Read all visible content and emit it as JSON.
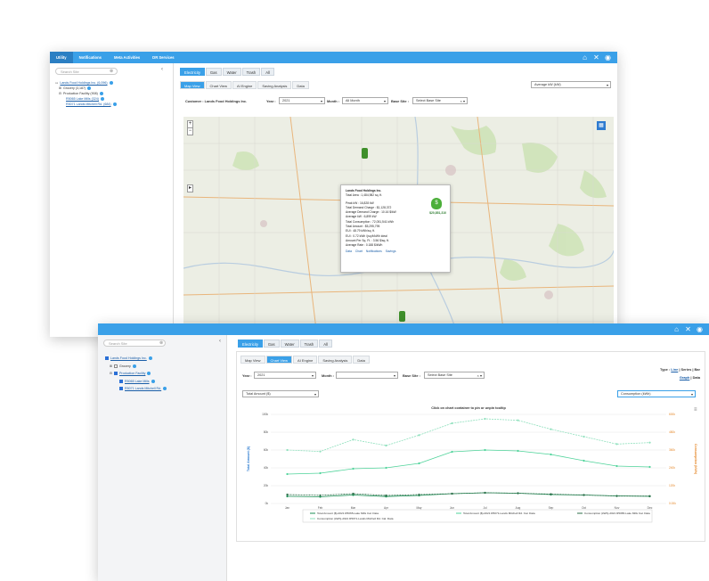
{
  "back_window": {
    "nav": [
      "Utility",
      "Notifications",
      "Meta Activities",
      "DR Services"
    ],
    "search_placeholder": "Search Site",
    "tree": {
      "root": "Lands Food Holdings Inc. (6,096)",
      "grocery": "Grocery (3,187)",
      "production": "Production Facility (908)",
      "site1": "R5065 Lake Mills (324)",
      "site2": "R5071 Lands Mitchell Rd. (684)"
    },
    "commodity_tabs": [
      "Electricity",
      "Gas",
      "Water",
      "Trash",
      "All"
    ],
    "view_tabs": [
      "Map View",
      "Chart View",
      "AI Engine",
      "Saving Analysis",
      "Data"
    ],
    "metric_select": "Average kW (kW)",
    "customer_label": "Customer : Lands Food Holdings Inc.",
    "year_label": "Year :",
    "year_value": "2021",
    "month_label": "Month :",
    "month_value": "All Month",
    "basesite_label": "Base Site :",
    "basesite_value": "Select Base Site",
    "popup": {
      "name": "Lands Food Holdings Inc.",
      "total_area": "Total Area : 1,484,982 sq. ft.",
      "lines": [
        "Peak kW : 16,828 kW",
        "Total Demand Charge : $1,128,372",
        "Average Demand Charge : 10.16 $/kW",
        "Average kW : 6,899 kW",
        "Total Consumption : 72,051,541 kWh",
        "Total Amount : $5,295,795",
        "EUI : 48.79 kWh/sq. ft.",
        "EUI : 0.72 kWh /(sq.ft/kWh ideal",
        "Amount Per Sq. Ft. : 3.56 $/sq. ft.",
        "Average Rate : 0.188 $/kWh"
      ],
      "amount": "$20,851,310",
      "links": [
        "Data",
        "Chart",
        "Notifications",
        "Savings"
      ]
    }
  },
  "front_window": {
    "search_placeholder": "Search Site",
    "tree": {
      "root": "Lands Food Holdings Inc.",
      "grocery": "Grocery",
      "production": "Production Facility",
      "site1": "R5065 Lake Mills",
      "site2": "R5071 Lands Mitchell Rd."
    },
    "commodity_tabs": [
      "Electricity",
      "Gas",
      "Water",
      "Trash",
      "All"
    ],
    "view_tabs": [
      "Map View",
      "Chart View",
      "AI Engine",
      "Saving Analysis",
      "Data"
    ],
    "type_label": "Type :",
    "type_options": [
      "Line",
      "Series",
      "Bar"
    ],
    "mode_options": [
      "Graph",
      "Data"
    ],
    "year_label": "Year :",
    "year_value": "2021",
    "month_label": "Month :",
    "month_value": "",
    "basesite_label": "Base Site :",
    "basesite_value": "Select Base Site",
    "left_metric": "Total Amount ($)",
    "right_metric": "Consumption (kWh)"
  },
  "chart_data": {
    "type": "line",
    "title": "Click on chart container to pin or unpin tooltip",
    "categories": [
      "Jan",
      "Feb",
      "Mar",
      "Apr",
      "May",
      "Jun",
      "Jul",
      "Aug",
      "Sep",
      "Oct",
      "Nov",
      "Dec"
    ],
    "ylabel": "Total Amount ($)",
    "y2label": "Consumption (kWh)",
    "ylim": [
      0,
      100000
    ],
    "yticks": [
      "0k",
      "20k",
      "40k",
      "60k",
      "80k",
      "100k"
    ],
    "y2lim": [
      0,
      600000
    ],
    "y2ticks": [
      "0.00k",
      "120k",
      "240k",
      "360k",
      "480k",
      "600k"
    ],
    "series": [
      {
        "name": "Total Amount ($)-2021 R5065-Lake Mills Cal. Data",
        "axis": "left",
        "color": "#1b8f55",
        "values": [
          8000,
          7500,
          9500,
          7800,
          9000,
          11000,
          12000,
          11500,
          10000,
          9500,
          8500,
          8000
        ]
      },
      {
        "name": "Total Amount ($)-2021 R5071-Lands Mitchell Rd. Cal. Data",
        "axis": "left",
        "color": "#4fd39a",
        "values": [
          33000,
          34000,
          39000,
          40000,
          45000,
          58000,
          60000,
          59000,
          55000,
          48000,
          42000,
          41000
        ]
      },
      {
        "name": "Consumption (kWh)-2021 R5065-Lake Mills Cal. Data",
        "axis": "right",
        "color": "#2c6e49",
        "values": [
          60000,
          55000,
          66000,
          54000,
          60000,
          66000,
          72000,
          69000,
          63000,
          57000,
          50000,
          50000
        ]
      },
      {
        "name": "Consumption (kWh)-2021 R5071-Lands Mitchell Rd. Cal. Data",
        "axis": "right",
        "color": "#8fe0bd",
        "values": [
          360000,
          350000,
          430000,
          390000,
          460000,
          540000,
          570000,
          560000,
          500000,
          450000,
          400000,
          410000
        ]
      }
    ]
  }
}
